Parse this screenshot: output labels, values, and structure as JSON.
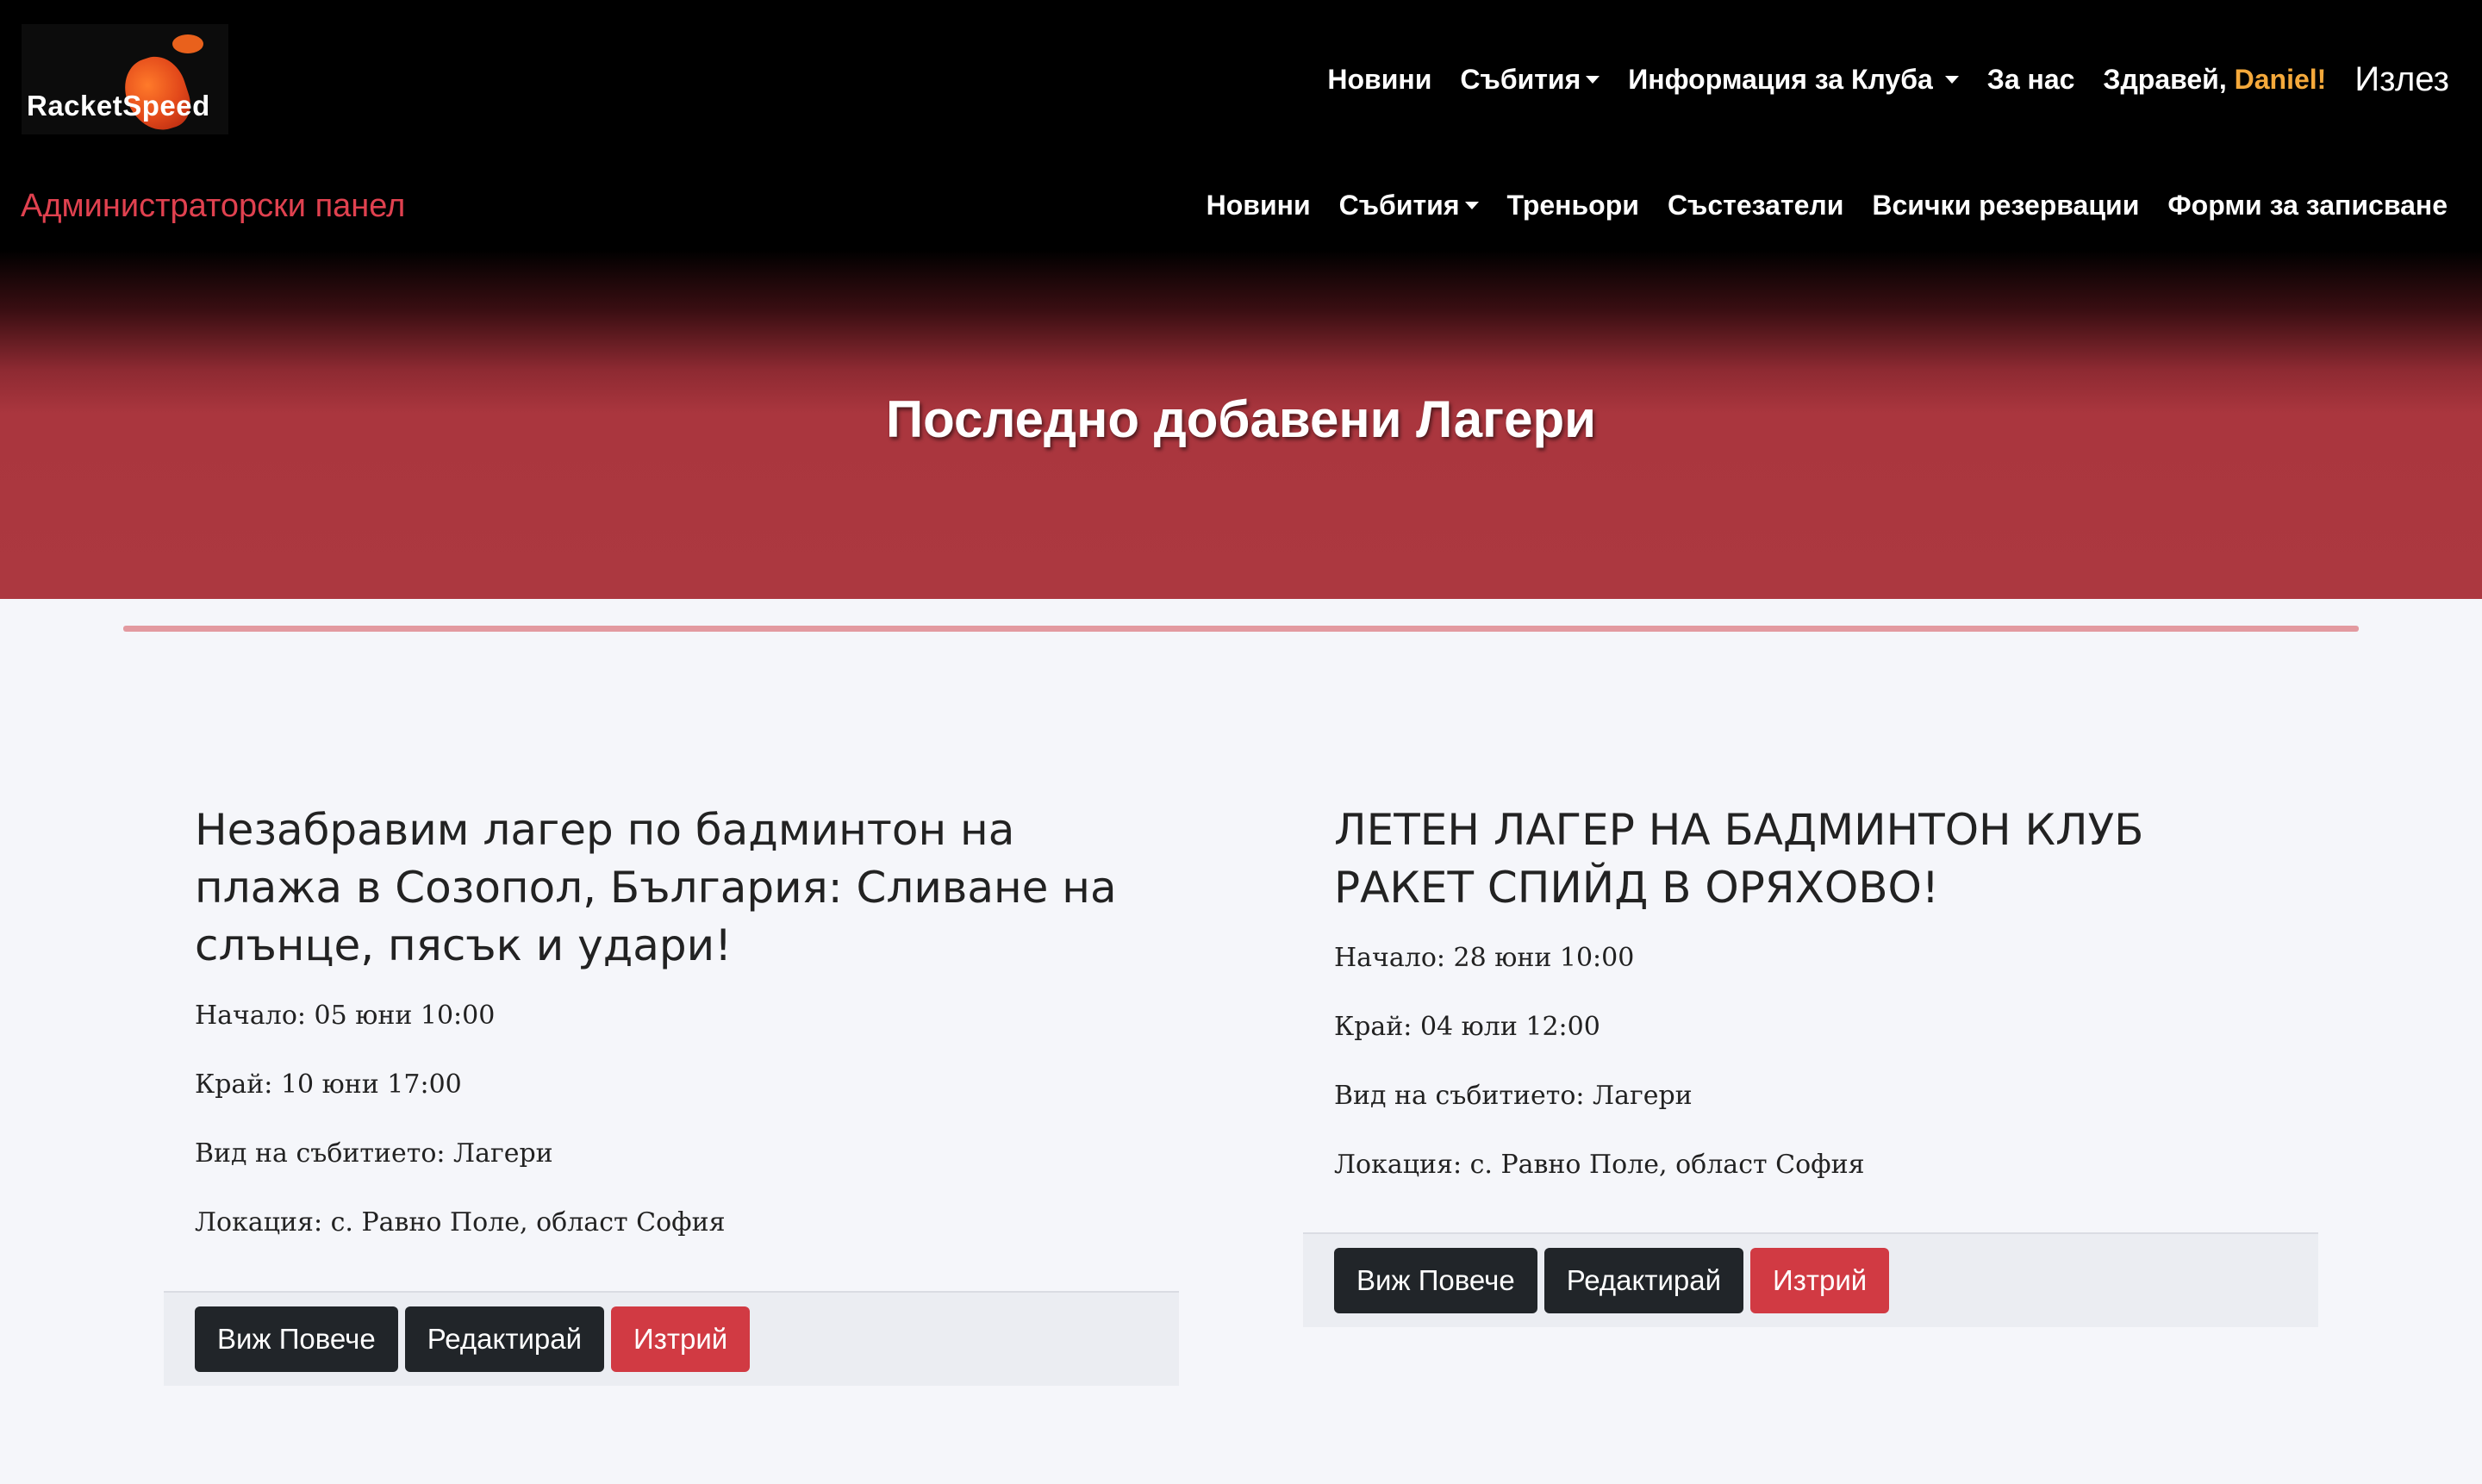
{
  "brand": {
    "logo_text": "RacketSpeed"
  },
  "nav_main": {
    "news": "Новини",
    "events": "Събития",
    "club_info": "Информация за Клуба",
    "about": "За нас",
    "greeting": "Здравей,",
    "user_name": "Daniel!",
    "logout": "Излез"
  },
  "admin": {
    "title": "Администраторски панел",
    "news": "Новини",
    "events": "Събития",
    "coaches": "Треньори",
    "competitors": "Състезатели",
    "reservations": "Всички резервации",
    "signup_forms": "Форми за записване"
  },
  "hero": {
    "title": "Последно добавени Лагери"
  },
  "cards": [
    {
      "title": "Незабравим лагер по бадминтон на плажа в Созопол, България: Сливане на слънце, пясък и удари!",
      "start": "Начало: 05 юни 10:00",
      "end": "Край: 10 юни 17:00",
      "type": "Вид на събитието: Лагери",
      "location": "Локация: с. Равно Поле, област София",
      "btn_more": "Виж Повече",
      "btn_edit": "Редактирай",
      "btn_delete": "Изтрий"
    },
    {
      "title": "ЛЕТЕН ЛАГЕР НА БАДМИНТОН КЛУБ РАКЕТ СПИЙД В ОРЯХОВО!",
      "start": "Начало: 28 юни 10:00",
      "end": "Край: 04 юли 12:00",
      "type": "Вид на събитието: Лагери",
      "location": "Локация: с. Равно Поле, област София",
      "btn_more": "Виж Повече",
      "btn_edit": "Редактирай",
      "btn_delete": "Изтрий"
    }
  ],
  "colors": {
    "accent_red": "#d13a43",
    "admin_title": "#e0414f",
    "user_name": "#f5a93b",
    "hero_red": "#ac3840"
  }
}
